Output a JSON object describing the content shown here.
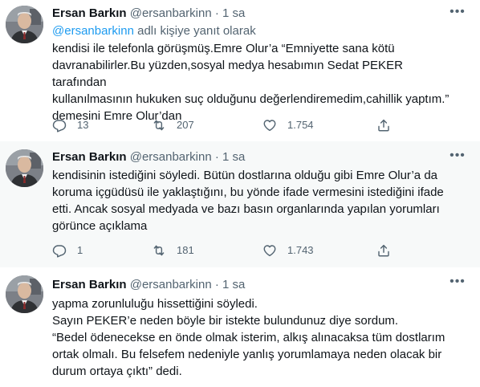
{
  "tweets": [
    {
      "name": "Ersan Barkın",
      "handle": "@ersanbarkinn",
      "dot": "·",
      "time": "1 sa",
      "reply_prefix": "@ersanbarkinn",
      "reply_suffix": " adlı kişiye yanıt olarak",
      "lines": [
        "kendisi ile telefonla görüşmüş.Emre Olur’a “Emniyette sana kötü",
        "davranabilirler.Bu yüzden,sosyal medya hesabımın Sedat PEKER tarafından",
        "kullanılmasının hukuken suç olduğunu değerlendiremedim,cahillik yaptım.”",
        "demesini Emre Olur’dan"
      ],
      "replies": "13",
      "retweets": "207",
      "likes": "1.754"
    },
    {
      "name": "Ersan Barkın",
      "handle": "@ersanbarkinn",
      "dot": "·",
      "time": "1 sa",
      "lines": [
        "kendisinin istediğini söyledi. Bütün dostlarına olduğu gibi Emre Olur’a da",
        "koruma içgüdüsü ile yaklaştığını, bu yönde ifade vermesini istediğini ifade",
        "etti. Ancak sosyal medyada ve bazı basın organlarında yapılan yorumları",
        "görünce açıklama"
      ],
      "replies": "1",
      "retweets": "181",
      "likes": "1.743"
    },
    {
      "name": "Ersan Barkın",
      "handle": "@ersanbarkinn",
      "dot": "·",
      "time": "1 sa",
      "lines": [
        "yapma zorunluluğu hissettiğini söyledi.",
        "Sayın PEKER’e neden böyle bir istekte bulundunuz diye sordum.",
        "“Bedel ödenecekse en önde olmak isterim, alkış alınacaksa tüm dostlarım",
        "ortak olmalı. Bu felsefem nedeniyle yanlış yorumlamaya neden olacak bir",
        "durum ortaya çıktı” dedi."
      ]
    }
  ],
  "icons": {
    "more": "more-horizontal-icon",
    "reply": "reply-bubble-icon",
    "retweet": "retweet-icon",
    "like": "heart-icon",
    "share": "share-upload-icon"
  },
  "colors": {
    "text_primary": "#0f1419",
    "text_secondary": "#536471",
    "mention": "#1d9bf0",
    "shaded_background": "#f7f9f9"
  }
}
